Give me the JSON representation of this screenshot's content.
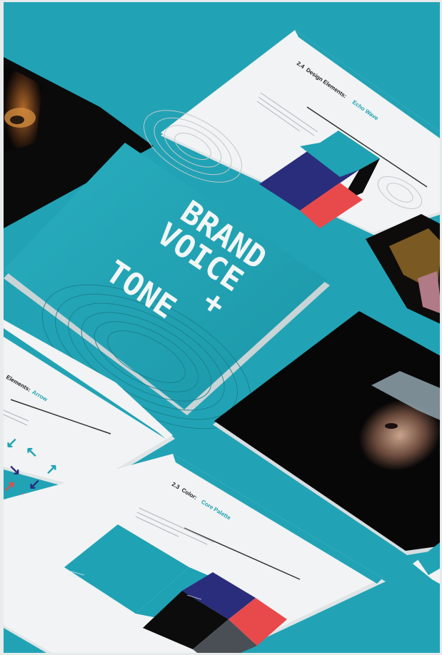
{
  "cover": {
    "line1": "BRAND",
    "line2": "VOICE",
    "line3": "+",
    "line4": "TONE"
  },
  "page_echo_wave": {
    "heading_number": "2.4",
    "heading_prefix": "Design Elements:",
    "heading_highlight": "Echo Wave"
  },
  "page_arrow": {
    "heading_prefix": "Elements:",
    "heading_highlight": "Arrow"
  },
  "page_core_palette": {
    "heading_number": "2.3",
    "heading_prefix": "Color:",
    "heading_highlight": "Core Palette"
  },
  "colors": {
    "background": "#21a3b5",
    "teal": "#1fa2b3",
    "navy": "#2a2d7c",
    "black": "#0c0c0c",
    "red": "#e84a4c",
    "paper": "#f1f3f4"
  }
}
